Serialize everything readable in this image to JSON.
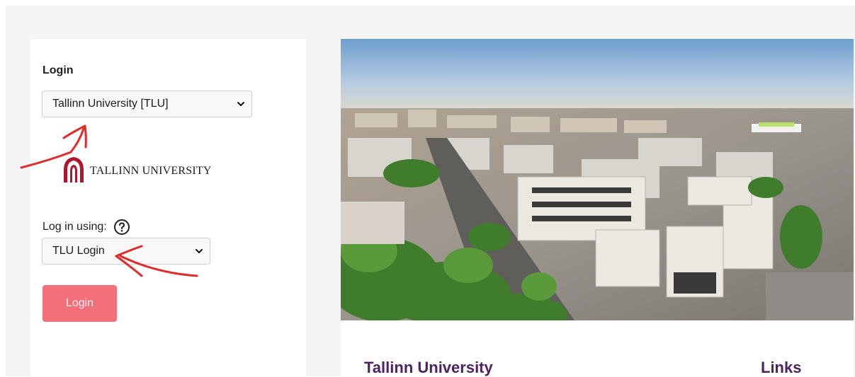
{
  "login_panel": {
    "heading": "Login",
    "organization_select": {
      "selected": "Tallinn University [TLU]"
    },
    "logo": {
      "text": "TALLINN UNIVERSITY"
    },
    "login_using_label": "Log in using:",
    "help_icon": "question-circle-icon",
    "method_select": {
      "selected": "TLU Login"
    },
    "login_button": "Login"
  },
  "main": {
    "hero_image": "aerial-city-photo-tallinn",
    "section_title": "Tallinn University",
    "links_title": "Links"
  },
  "colors": {
    "accent": "#f36f7a",
    "title_purple": "#4b2364",
    "logo_red": "#b0152b",
    "annotation_red": "#e12a2a"
  }
}
